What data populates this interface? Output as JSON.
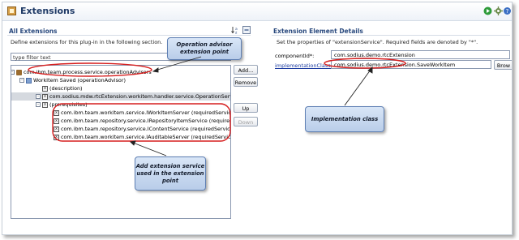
{
  "window": {
    "title": "Extensions"
  },
  "left": {
    "section_title": "All Extensions",
    "description": "Define extensions for this plug-in in the following section.",
    "filter_value": "type filter text",
    "tree": [
      {
        "label": "com.ibm.team.process.service.operationAdvisors",
        "level": 0,
        "icon": "ext",
        "twisty": "-"
      },
      {
        "label": "WorkItem Saved (operationAdvisor)",
        "level": 1,
        "icon": "el",
        "twisty": "-"
      },
      {
        "label": "(description)",
        "level": 2,
        "icon": "x",
        "twisty": ""
      },
      {
        "label": "com.sodius.mdw.rtcExtension.workitem.handler.service.OperationServerAdvisor",
        "level": 2,
        "icon": "x",
        "twisty": "-",
        "selected": true
      },
      {
        "label": "(prerequisites)",
        "level": 3,
        "icon": "x",
        "twisty": "-"
      },
      {
        "label": "com.ibm.team.workitem.service.IWorkItemServer (requiredService)",
        "level": 4,
        "icon": "x",
        "twisty": ""
      },
      {
        "label": "com.ibm.team.repository.service.IRepositoryItemService (requiredService)",
        "level": 4,
        "icon": "x",
        "twisty": ""
      },
      {
        "label": "com.ibm.team.repository.service.IContentService (requiredService)",
        "level": 4,
        "icon": "x",
        "twisty": ""
      },
      {
        "label": "com.ibm.team.workitem.service.IAuditableServer (requiredService)",
        "level": 4,
        "icon": "x",
        "twisty": ""
      }
    ],
    "buttons": {
      "add": "Add...",
      "remove": "Remove",
      "up": "Up",
      "down": "Down"
    }
  },
  "right": {
    "section_title": "Extension Element Details",
    "description": "Set the properties of \"extensionService\". Required fields are denoted by \"*\".",
    "fields": {
      "component_label": "componentId*:",
      "component_value": "com.sodius.demo.rtcExtension",
      "impl_label": "implementationClass*:",
      "impl_value": "com.sodius.demo.rtcExtension.SaveWorkItem",
      "browse": "Brow"
    }
  },
  "callouts": {
    "operation_advisor": "Operation advisor extension point",
    "add_service": "Add extension service used in the extension point",
    "implementation": "Implementation class"
  },
  "colors": {
    "annotation_red": "#d61e1e",
    "callout_fill": "#c9dbf2",
    "title_blue": "#1f3a66"
  },
  "icons": [
    "extensions-icon",
    "run-icon",
    "settings-icon",
    "help-icon",
    "sort-icon",
    "collapse-icon"
  ]
}
